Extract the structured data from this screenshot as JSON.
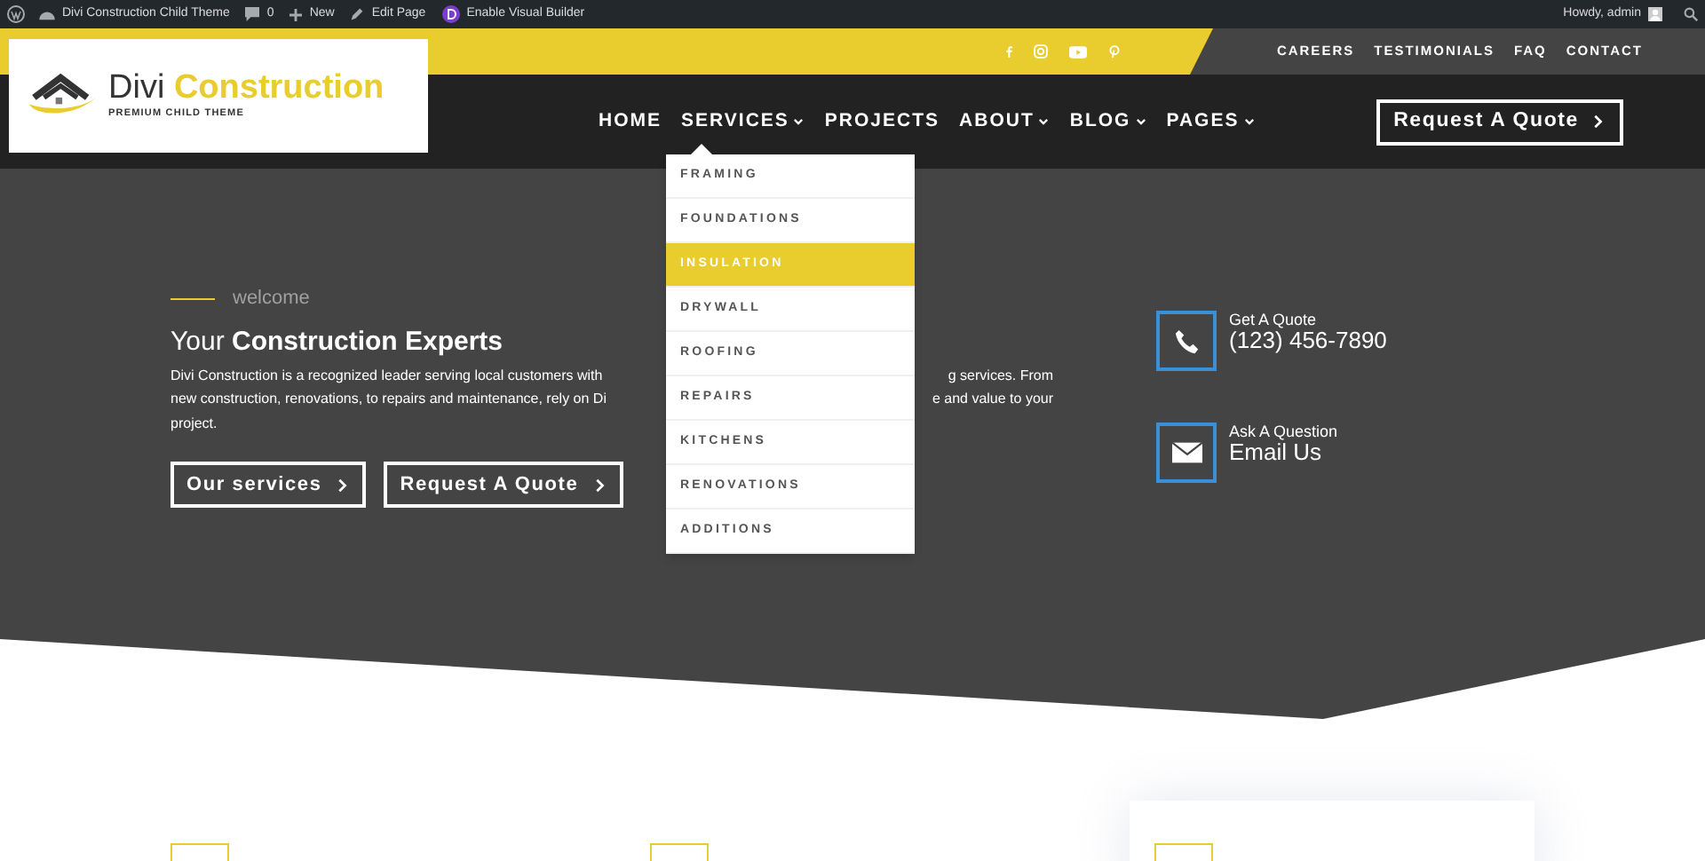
{
  "admin_bar": {
    "items": [
      {
        "kind": "site",
        "label": "Divi Construction Child Theme"
      },
      {
        "kind": "comments",
        "label": "0"
      },
      {
        "kind": "new",
        "label": "New"
      },
      {
        "kind": "edit",
        "label": "Edit Page"
      },
      {
        "kind": "builder",
        "label": "Enable Visual Builder"
      }
    ],
    "greeting": "Howdy, admin"
  },
  "top_bar": {
    "links": [
      "CAREERS",
      "TESTIMONIALS",
      "FAQ",
      "CONTACT"
    ]
  },
  "logo": {
    "name_first": "Divi",
    "name_second": "Construction",
    "tagline": "PREMIUM CHILD THEME"
  },
  "nav": {
    "items": [
      {
        "label": "HOME",
        "dropdown": false
      },
      {
        "label": "SERVICES",
        "dropdown": true,
        "submenu": [
          {
            "label": "FRAMING",
            "selected": false
          },
          {
            "label": "FOUNDATIONS",
            "selected": false
          },
          {
            "label": "INSULATION",
            "selected": true
          },
          {
            "label": "DRYWALL",
            "selected": false
          },
          {
            "label": "ROOFING",
            "selected": false
          },
          {
            "label": "REPAIRS",
            "selected": false
          },
          {
            "label": "KITCHENS",
            "selected": false
          },
          {
            "label": "RENOVATIONS",
            "selected": false
          },
          {
            "label": "ADDITIONS",
            "selected": false
          }
        ]
      },
      {
        "label": "PROJECTS",
        "dropdown": false
      },
      {
        "label": "ABOUT",
        "dropdown": true
      },
      {
        "label": "BLOG",
        "dropdown": true
      },
      {
        "label": "PAGES",
        "dropdown": true
      }
    ],
    "cta": "Request A Quote"
  },
  "hero": {
    "eyebrow": "welcome",
    "heading": "Your **Construction Experts**",
    "paragraph_lines": [
      {
        "left": "Divi Construction is a recognized leader serving local customers with",
        "right": "g services. From"
      },
      {
        "left": "new construction, renovations, to repairs and maintenance, rely on Di",
        "right": "e and value to your"
      },
      {
        "left": "project."
      }
    ],
    "buttons": [
      "Our services",
      "Request A Quote"
    ],
    "contacts": [
      {
        "kind": "phone",
        "label": "Get A Quote",
        "value": "(123) 456-7890"
      },
      {
        "kind": "email",
        "label": "Ask A Question",
        "value": "Email Us"
      }
    ]
  }
}
